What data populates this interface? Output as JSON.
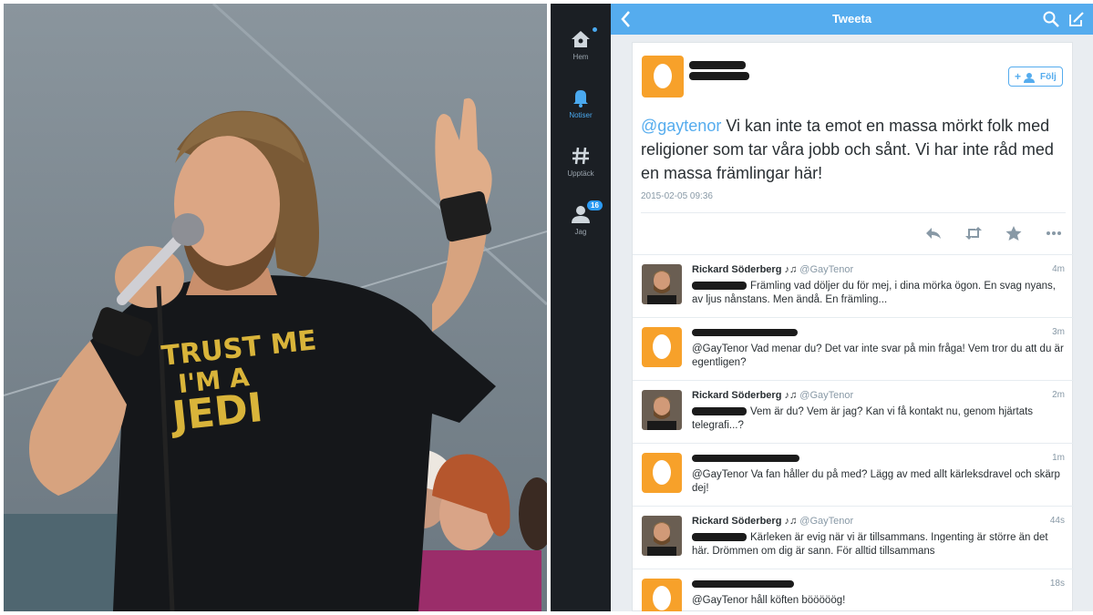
{
  "colors": {
    "twitter_blue": "#55acee",
    "egg_orange": "#f7a12a",
    "nav_dark": "#1b1f24",
    "text": "#292f33",
    "muted": "#8899a6"
  },
  "photo": {
    "shirt_text_line1": "TRUST ME",
    "shirt_text_line2": "I'M A",
    "shirt_text_line3": "JEDI"
  },
  "nav": {
    "items": [
      {
        "label": "Hem",
        "icon": "home-icon"
      },
      {
        "label": "Notiser",
        "icon": "bell-icon"
      },
      {
        "label": "Upptäck",
        "icon": "hashtag-icon"
      },
      {
        "label": "Jag",
        "icon": "profile-icon",
        "badge": "16"
      }
    ]
  },
  "header": {
    "title": "Tweeta",
    "back_icon": "chevron-left-icon",
    "search_icon": "search-icon",
    "compose_icon": "compose-icon"
  },
  "main_tweet": {
    "follow_label": "Följ",
    "mention": "@gaytenor",
    "text": " Vi kan inte ta emot en massa mörkt folk med religioner som tar våra jobb och sånt. Vi har inte råd med en massa främlingar här!",
    "date": "2015-02-05 09:36",
    "actions": [
      "reply-icon",
      "retweet-icon",
      "favorite-icon",
      "more-icon"
    ]
  },
  "replies": [
    {
      "type": "user",
      "name": "Rickard Söderberg ♪♫",
      "handle": "@GayTenor",
      "time": "4m",
      "text": "Främling vad döljer du för mej, i dina mörka ögon. En svag nyans, av ljus nånstans. Men ändå. En främling..."
    },
    {
      "type": "egg",
      "time": "3m",
      "text": "@GayTenor Vad menar du? Det var inte svar på min fråga! Vem tror du att du är egentligen?"
    },
    {
      "type": "user",
      "name": "Rickard Söderberg ♪♫",
      "handle": "@GayTenor",
      "time": "2m",
      "text": "Vem är du? Vem är jag? Kan vi få kontakt nu, genom hjärtats telegrafi...?"
    },
    {
      "type": "egg",
      "time": "1m",
      "text": "@GayTenor Va fan håller du på med? Lägg av med allt kärleksdravel och skärp dej!"
    },
    {
      "type": "user",
      "name": "Rickard Söderberg ♪♫",
      "handle": "@GayTenor",
      "time": "44s",
      "text": "Kärleken är evig när vi är tillsammans. Ingenting är större än det här. Drömmen om dig är sann. För alltid tillsammans"
    },
    {
      "type": "egg",
      "time": "18s",
      "text": "@GayTenor håll köften bööööög!"
    }
  ]
}
